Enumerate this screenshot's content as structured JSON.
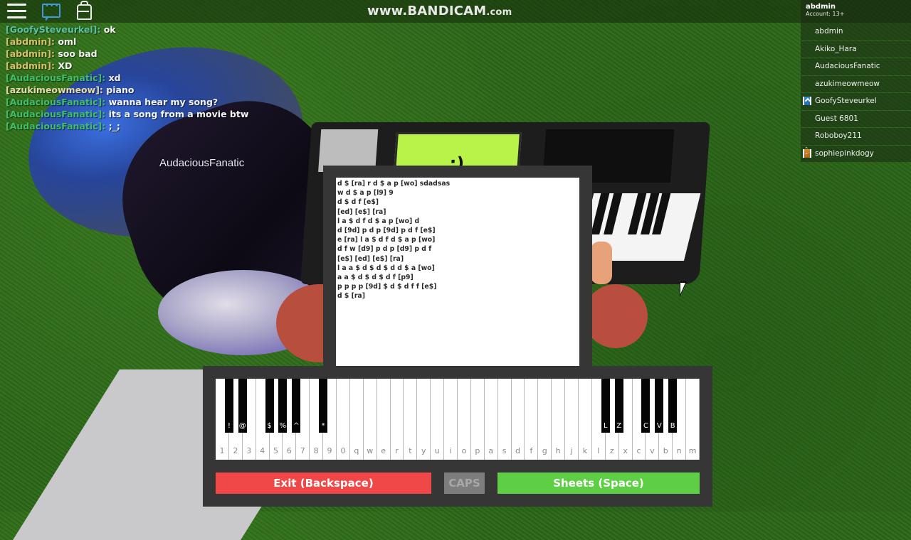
{
  "topbar": {
    "icons": [
      "menu-icon",
      "chat-icon",
      "backpack-icon"
    ],
    "watermark_main": "www.BANDICAM",
    "watermark_suffix": ".com"
  },
  "colors": {
    "name_green": "#3fbf6a",
    "name_gold": "#d8c06a",
    "name_teal": "#59c2a4",
    "name_lightgreen": "#8fd07a",
    "exit_red": "#f04848",
    "sheets_green": "#5ece45",
    "caps_gray": "#7d7d7d",
    "panel_dark": "#363636",
    "screen_lime": "#b9f34a"
  },
  "chat": {
    "messages": [
      {
        "speaker": "[GoofySteveurkel]:",
        "text": "ok",
        "color": "#59c2a4"
      },
      {
        "speaker": "[abdmin]:",
        "text": "oml",
        "color": "#d8c06a"
      },
      {
        "speaker": "[abdmin]:",
        "text": "soo bad",
        "color": "#d8c06a"
      },
      {
        "speaker": "[abdmin]:",
        "text": "XD",
        "color": "#d8c06a"
      },
      {
        "speaker": "[AudaciousFanatic]:",
        "text": "xd",
        "color": "#3fbf6a"
      },
      {
        "speaker": "[azukimeowmeow]:",
        "text": "piano",
        "color": "#e6dca8"
      },
      {
        "speaker": "[AudaciousFanatic]:",
        "text": "wanna hear my song?",
        "color": "#3fbf6a"
      },
      {
        "speaker": "[AudaciousFanatic]:",
        "text": "its a song from a movie btw",
        "color": "#3fbf6a"
      },
      {
        "speaker": "[AudaciousFanatic]:",
        "text": ";_;",
        "color": "#3fbf6a"
      }
    ]
  },
  "playerlist": {
    "local_user": "abdmin",
    "account_label": "Account: 13+",
    "players": [
      {
        "name": "abdmin",
        "badge": ""
      },
      {
        "name": "Akiko_Hara",
        "badge": ""
      },
      {
        "name": "AudaciousFanatic",
        "badge": ""
      },
      {
        "name": "azukimeowmeow",
        "badge": ""
      },
      {
        "name": "GoofySteveurkel",
        "badge": "blue"
      },
      {
        "name": "Guest 6801",
        "badge": ""
      },
      {
        "name": "Roboboy211",
        "badge": ""
      },
      {
        "name": "sophiepinkdogy",
        "badge": "orange"
      }
    ]
  },
  "scene": {
    "player_nametag": "AudaciousFanatic",
    "piano_screen_text": ";)"
  },
  "sheet": {
    "lines": [
      "d $ [ra] r d $ a p [wo] sdadsas",
      "w d $ a p [l9] 9",
      "d $ d f [e$]",
      "[ed] [e$] [ra]",
      "l a $ d f d $ a p [wo] d",
      "d [9d] p d p [9d] p d f [e$]",
      "e [ra] l a $ d f d $ a p [wo]",
      "d f w [d9] p d p [d9] p d f",
      "[e$] [ed] [e$] [ra]",
      "l a a $ d $ d $ d d $ a [wo]",
      "a a $ d $ d $ d f [p9]",
      "p p p p [9d] $ d $ d f f [e$]",
      "d $ [ra]"
    ]
  },
  "keyboard": {
    "white_keys": [
      "1",
      "2",
      "3",
      "4",
      "5",
      "6",
      "7",
      "8",
      "9",
      "0",
      "q",
      "w",
      "e",
      "r",
      "t",
      "y",
      "u",
      "i",
      "o",
      "p",
      "a",
      "s",
      "d",
      "f",
      "g",
      "h",
      "j",
      "k",
      "l",
      "z",
      "x",
      "c",
      "v",
      "b",
      "n",
      "m"
    ],
    "black_keys": [
      {
        "after": 0,
        "label": "!"
      },
      {
        "after": 1,
        "label": "@"
      },
      {
        "after": 3,
        "label": "$"
      },
      {
        "after": 4,
        "label": "%"
      },
      {
        "after": 5,
        "label": "^"
      },
      {
        "after": 7,
        "label": "*"
      },
      {
        "after": 28,
        "label": "L"
      },
      {
        "after": 29,
        "label": "Z"
      },
      {
        "after": 31,
        "label": "C"
      },
      {
        "after": 32,
        "label": "V"
      },
      {
        "after": 33,
        "label": "B"
      }
    ],
    "exit_label": "Exit (Backspace)",
    "caps_label": "CAPS",
    "sheets_label": "Sheets (Space)"
  }
}
